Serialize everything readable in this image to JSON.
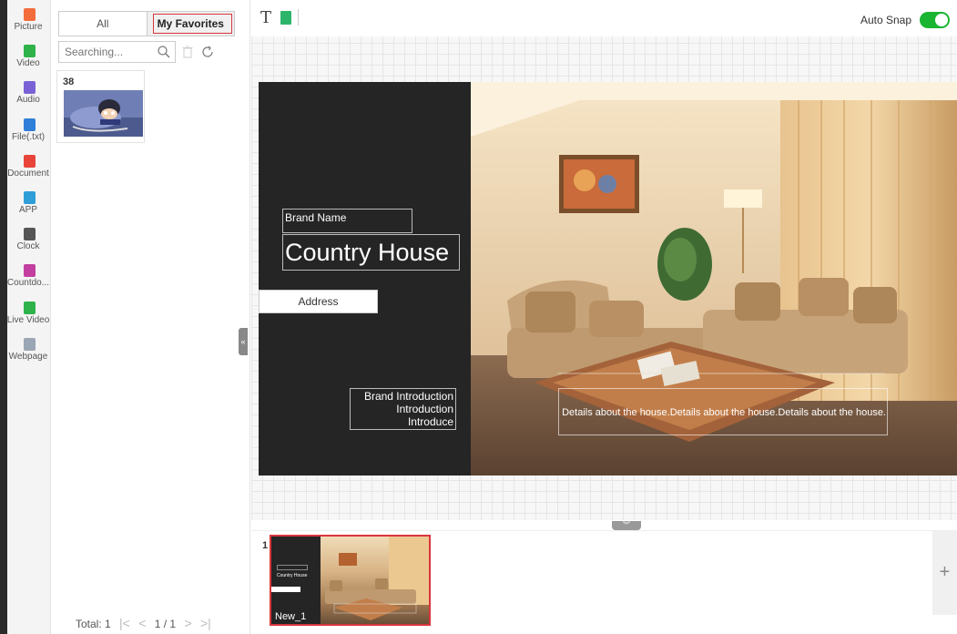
{
  "sidebar": {
    "items": [
      {
        "label": "Picture",
        "icon": "picture-icon",
        "color": "#f36c3c"
      },
      {
        "label": "Video",
        "icon": "video-icon",
        "color": "#2fb24a"
      },
      {
        "label": "Audio",
        "icon": "audio-icon",
        "color": "#7a62d6"
      },
      {
        "label": "File(.txt)",
        "icon": "file-icon",
        "color": "#2f7ed8"
      },
      {
        "label": "Document",
        "icon": "pdf-icon",
        "color": "#e8443a"
      },
      {
        "label": "APP",
        "icon": "app-icon",
        "color": "#2f9ed8"
      },
      {
        "label": "Clock",
        "icon": "clock-icon",
        "color": "#555555"
      },
      {
        "label": "Countdo...",
        "icon": "countdown-icon",
        "color": "#c23fa0"
      },
      {
        "label": "Live Video",
        "icon": "live-video-icon",
        "color": "#2fb24a"
      },
      {
        "label": "Webpage",
        "icon": "webpage-icon",
        "color": "#9aa6b3"
      }
    ]
  },
  "media": {
    "tabs": {
      "all": "All",
      "favorites": "My Favorites"
    },
    "search_placeholder": "Searching...",
    "card_count": "38",
    "pager": {
      "total": "Total: 1",
      "page": "1 / 1"
    }
  },
  "toolbar": {
    "text_tool": "T",
    "autosnap_label": "Auto Snap",
    "autosnap_on": true
  },
  "slide": {
    "brand_name": "Brand Name",
    "title": "Country House",
    "address": "Address",
    "intro_lines": [
      "Brand Introduction",
      "Introduction",
      "Introduce"
    ],
    "details": "Details about the house.Details about the house.Details about the house."
  },
  "pages": {
    "number": "1",
    "name": "New_1",
    "thumb_title": "Country House",
    "add_label": "+"
  },
  "colors": {
    "accent_red": "#d9363e",
    "toggle_green": "#19b532",
    "slide_bg": "#252525"
  }
}
